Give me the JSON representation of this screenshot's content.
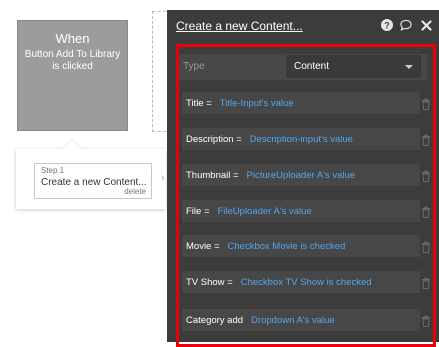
{
  "trigger": {
    "title": "When",
    "subtitle": "Button Add To Library is clicked"
  },
  "step": {
    "label": "Step 1",
    "name": "Create a new Content...",
    "delete_label": "delete"
  },
  "panel": {
    "title": "Create a new Content...",
    "icons": [
      "help-icon",
      "comment-icon",
      "close-icon"
    ],
    "type_label": "Type",
    "type_value": "Content",
    "fields": [
      {
        "name": "Title =",
        "expr": "Title-Input's value"
      },
      {
        "name": "Description =",
        "expr": "Description-input's value"
      },
      {
        "name": "Thumbnail =",
        "expr": "PictureUploader A's value"
      },
      {
        "name": "File =",
        "expr": "FileUploader A's value"
      },
      {
        "name": "Movie =",
        "expr": "Checkbox Movie is checked"
      },
      {
        "name": "TV Show =",
        "expr": "Checkbox TV Show is checked"
      },
      {
        "name": "Category add",
        "expr": "Dropdown A's value"
      }
    ]
  },
  "colors": {
    "panel_bg": "#3c3c3c",
    "expression": "#55a6ec",
    "highlight": "#e8000b",
    "trigger_bg": "#9c9c9c"
  }
}
